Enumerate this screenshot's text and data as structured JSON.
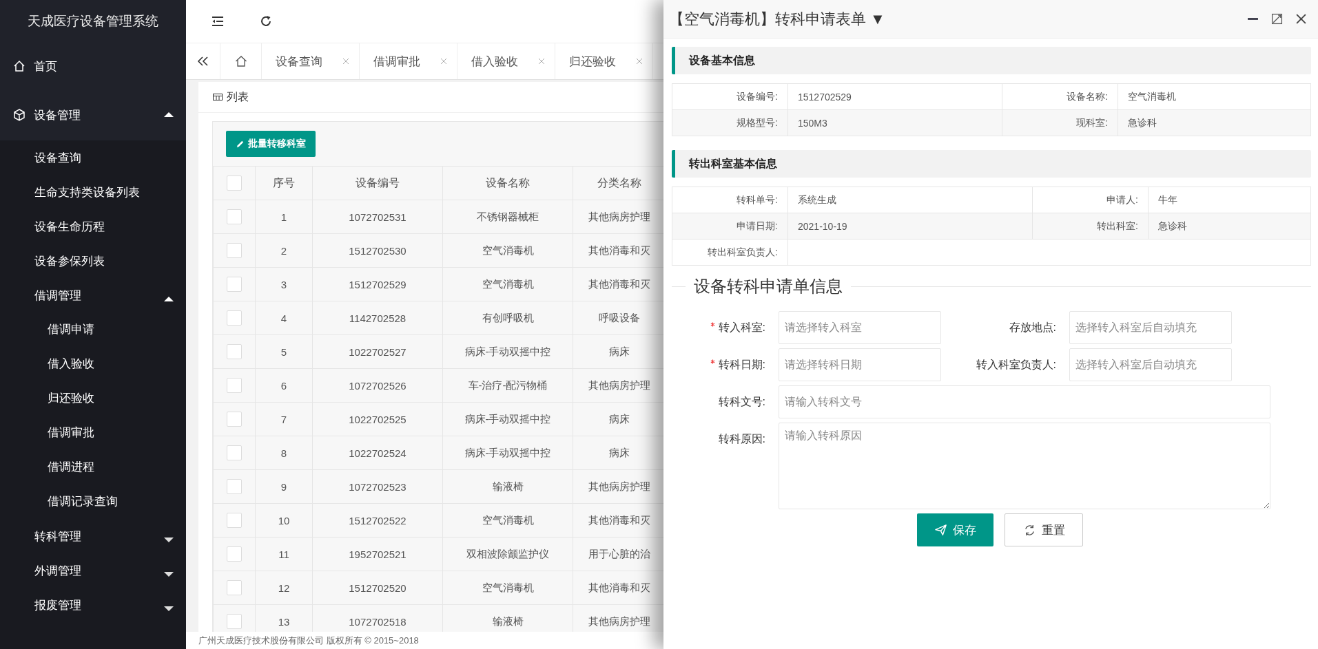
{
  "app_title": "天成医疗设备管理系统",
  "sidebar": {
    "items": [
      {
        "label": "首页"
      },
      {
        "label": "设备管理",
        "expanded": true,
        "children": [
          {
            "label": "设备查询"
          },
          {
            "label": "生命支持类设备列表"
          },
          {
            "label": "设备生命历程"
          },
          {
            "label": "设备参保列表"
          },
          {
            "label": "借调管理",
            "expanded": true,
            "children": [
              {
                "label": "借调申请"
              },
              {
                "label": "借入验收"
              },
              {
                "label": "归还验收"
              },
              {
                "label": "借调审批"
              },
              {
                "label": "借调进程"
              },
              {
                "label": "借调记录查询"
              }
            ]
          },
          {
            "label": "转科管理",
            "expanded": false
          },
          {
            "label": "外调管理",
            "expanded": false
          },
          {
            "label": "报废管理",
            "expanded": false
          }
        ]
      }
    ]
  },
  "tabs": [
    {
      "label": "设备查询",
      "selected": false
    },
    {
      "label": "借调审批",
      "selected": false
    },
    {
      "label": "借入验收",
      "selected": false
    },
    {
      "label": "归还验收",
      "selected": false
    }
  ],
  "panel": {
    "title": "列表",
    "batch_button": "批量转移科室"
  },
  "table": {
    "header_checked": false,
    "columns": [
      "序号",
      "设备编号",
      "设备名称",
      "分类名称"
    ],
    "rows": [
      {
        "checked": false,
        "cells": [
          "1",
          "1072702531",
          "不锈钢器械柜",
          "其他病房护理"
        ]
      },
      {
        "checked": false,
        "cells": [
          "2",
          "1512702530",
          "空气消毒机",
          "其他消毒和灭"
        ]
      },
      {
        "checked": false,
        "cells": [
          "3",
          "1512702529",
          "空气消毒机",
          "其他消毒和灭"
        ]
      },
      {
        "checked": false,
        "cells": [
          "4",
          "1142702528",
          "有创呼吸机",
          "呼吸设备"
        ]
      },
      {
        "checked": false,
        "cells": [
          "5",
          "1022702527",
          "病床-手动双摇中控",
          "病床"
        ]
      },
      {
        "checked": false,
        "cells": [
          "6",
          "1072702526",
          "车-治疗-配污物桶",
          "其他病房护理"
        ]
      },
      {
        "checked": false,
        "cells": [
          "7",
          "1022702525",
          "病床-手动双摇中控",
          "病床"
        ]
      },
      {
        "checked": false,
        "cells": [
          "8",
          "1022702524",
          "病床-手动双摇中控",
          "病床"
        ]
      },
      {
        "checked": false,
        "cells": [
          "9",
          "1072702523",
          "输液椅",
          "其他病房护理"
        ]
      },
      {
        "checked": false,
        "cells": [
          "10",
          "1512702522",
          "空气消毒机",
          "其他消毒和灭"
        ]
      },
      {
        "checked": false,
        "cells": [
          "11",
          "1952702521",
          "双相波除颤监护仪",
          "用于心脏的治"
        ]
      },
      {
        "checked": false,
        "cells": [
          "12",
          "1512702520",
          "空气消毒机",
          "其他消毒和灭"
        ]
      },
      {
        "checked": false,
        "cells": [
          "13",
          "1072702518",
          "输液椅",
          "其他病房护理"
        ]
      }
    ]
  },
  "footer": "广州天成医疗技术股份有限公司 版权所有 © 2015~2018",
  "dialog": {
    "title": "【空气消毒机】转科申请表单 ▼",
    "sections": [
      {
        "title": "设备基本信息",
        "rows": [
          [
            {
              "label": "设备编号:",
              "value": "1512702529"
            },
            {
              "label": "设备名称:",
              "value": "空气消毒机"
            }
          ],
          [
            {
              "label": "规格型号:",
              "value": "150M3"
            },
            {
              "label": "现科室:",
              "value": "急诊科"
            }
          ]
        ]
      },
      {
        "title": "转出科室基本信息",
        "rows": [
          [
            {
              "label": "转科单号:",
              "value": "系统生成"
            },
            {
              "label": "申请人:",
              "value": "牛年"
            }
          ],
          [
            {
              "label": "申请日期:",
              "value": "2021-10-19"
            },
            {
              "label": "转出科室:",
              "value": "急诊科"
            }
          ],
          [
            {
              "label": "转出科室负责人:"
            }
          ]
        ]
      }
    ],
    "form": {
      "legend": "设备转科申请单信息",
      "rows": [
        [
          {
            "label": "转入科室:",
            "required": true,
            "placeholder": "请选择转入科室",
            "kind": "input"
          },
          {
            "label": "存放地点:",
            "required": false,
            "placeholder": "选择转入科室后自动填充",
            "kind": "input"
          }
        ],
        [
          {
            "label": "转科日期:",
            "required": true,
            "placeholder": "请选择转科日期",
            "kind": "input"
          },
          {
            "label": "转入科室负责人:",
            "required": false,
            "placeholder": "选择转入科室后自动填充",
            "kind": "input"
          }
        ],
        [
          {
            "label": "转科文号:",
            "required": false,
            "placeholder": "请输入转科文号",
            "kind": "input"
          }
        ],
        [
          {
            "label": "转科原因:",
            "required": false,
            "placeholder": "请输入转科原因",
            "kind": "textarea"
          }
        ]
      ]
    },
    "buttons": [
      "保存",
      "重置"
    ]
  }
}
